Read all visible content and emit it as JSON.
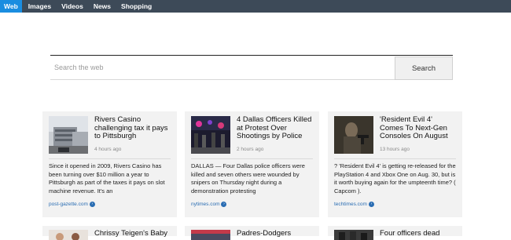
{
  "nav": {
    "tabs": [
      {
        "label": "Web",
        "active": true
      },
      {
        "label": "Images"
      },
      {
        "label": "Videos"
      },
      {
        "label": "News"
      },
      {
        "label": "Shopping"
      }
    ]
  },
  "search": {
    "placeholder": "Search the web",
    "button_label": "Search"
  },
  "news": [
    {
      "headline": "Rivers Casino challenging tax it pays to Pittsburgh",
      "age": "4 hours ago",
      "summary": "Since it opened in 2009, Rivers Casino has been turning over $10 million a year to Pittsburgh as part of the taxes it pays on slot machine revenue. It's an",
      "source": "post-gazette.com"
    },
    {
      "headline": "4 Dallas Officers Killed at Protest Over Shootings by Police",
      "age": "2 hours ago",
      "summary": "DALLAS — Four Dallas police officers were killed and seven others were wounded by snipers on Thursday night during a demonstration protesting",
      "source": "nytimes.com"
    },
    {
      "headline": "'Resident Evil 4' Comes To Next-Gen Consoles On August",
      "age": "13 hours ago",
      "summary": "? 'Resident Evil 4' is getting re-released for the PlayStation 4 and Xbox One on Aug. 30, but is it worth buying again for the umpteenth time? ( Capcom ).",
      "source": "techtimes.com"
    },
    {
      "headline": "Chrissy Teigen's Baby"
    },
    {
      "headline": "Padres-Dodgers"
    },
    {
      "headline": "Four officers dead"
    }
  ],
  "colors": {
    "topbar": "#3d4a58",
    "active_tab": "#1a8de0",
    "card_bg": "#f2f2f2",
    "source_link": "#2a6db3"
  },
  "icons": {
    "source": "arrow-circle-icon"
  }
}
